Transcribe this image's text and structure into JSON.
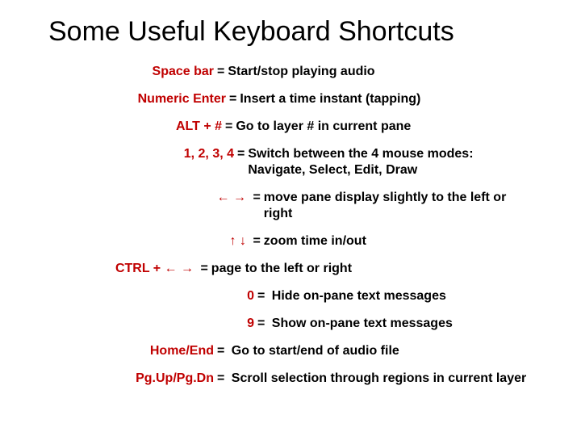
{
  "title": "Some Useful Keyboard Shortcuts",
  "rows": [
    {
      "key": "Space bar",
      "desc": "Start/stop playing audio"
    },
    {
      "key": "Numeric Enter",
      "desc": "Insert a time instant (tapping)"
    },
    {
      "key": "ALT + #",
      "desc": "Go to layer # in current pane"
    },
    {
      "key": "1, 2, 3, 4",
      "desc": "Switch between the 4 mouse modes: Navigate, Select, Edit, Draw"
    },
    {
      "key": "← →",
      "desc": "move pane display slightly to the left or right"
    },
    {
      "key": "↑ ↓",
      "desc": "zoom time in/out"
    },
    {
      "key": "CTRL + ← →",
      "desc": "page to the left or right"
    },
    {
      "key": "0",
      "desc": "Hide on-pane text messages"
    },
    {
      "key": "9",
      "desc": "Show on-pane text messages"
    },
    {
      "key": "Home/End",
      "desc": "Go to start/end of audio file"
    },
    {
      "key": "Pg.Up/Pg.Dn",
      "desc": "Scroll selection through regions in current layer"
    }
  ]
}
